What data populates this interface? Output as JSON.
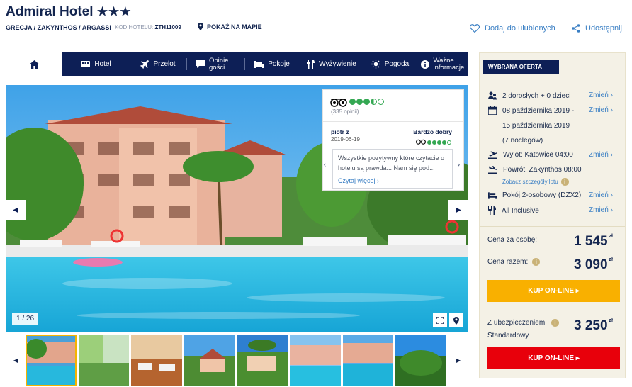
{
  "hotel": {
    "name": "Admiral Hotel",
    "stars": "★★★",
    "location": "GRECJA / ZAKYNTHOS / ARGASSI",
    "code_label": "KOD HOTELU:",
    "code": "ZTH11009",
    "map_link": "POKAŻ NA MAPIE"
  },
  "actions": {
    "favorite": "Dodaj do ulubionych",
    "share": "Udostępnij"
  },
  "tabs": [
    {
      "label": "Hotel",
      "icon": "hotel-icon"
    },
    {
      "label": "Przelot",
      "icon": "plane-icon"
    },
    {
      "label": "Opinie gości",
      "icon": "comment-icon"
    },
    {
      "label": "Pokoje",
      "icon": "bed-icon"
    },
    {
      "label": "Wyżywienie",
      "icon": "cutlery-icon"
    },
    {
      "label": "Pogoda",
      "icon": "sun-icon"
    },
    {
      "label": "Ważne informacje",
      "icon": "info-icon"
    }
  ],
  "gallery": {
    "counter": "1 / 26",
    "thumbnail_count": 8
  },
  "review": {
    "rating_count": "(335 opinii)",
    "rating": 3.5,
    "author": "piotr z",
    "date": "2019-06-19",
    "verdict": "Bardzo dobry",
    "verdict_rating": 4,
    "text": "Wszystkie pozytywny które czytacie o hotelu są prawda... Nam się pod...",
    "read_more": "Czytaj więcej"
  },
  "offer": {
    "header": "WYBRANA OFERTA",
    "change": "Zmień",
    "guests": "2 dorosłych + 0 dzieci",
    "date_from": "08 października 2019 -",
    "date_to": "15 października 2019",
    "nights": "(7 noclegów)",
    "departure": "Wylot: Katowice 04:00",
    "return": "Powrót: Zakynthos 08:00",
    "flight_details": "Zobacz szczegóły lotu",
    "room": "Pokój 2-osobowy (DZX2)",
    "board": "All Inclusive",
    "price_per_person_label": "Cena za osobę:",
    "price_per_person": "1 545",
    "price_total_label": "Cena razem:",
    "price_total": "3 090",
    "currency": "zł",
    "buy_label": "KUP ON-LINE ▸",
    "insurance_label": "Z ubezpieczeniem:",
    "insurance_type": "Standardowy",
    "price_insurance": "3 250"
  },
  "colors": {
    "navy": "#0d1f56",
    "link": "#3a7fc4",
    "buy_yellow": "#f9b000",
    "buy_red": "#e8000b",
    "tripadvisor_green": "#34a853"
  }
}
